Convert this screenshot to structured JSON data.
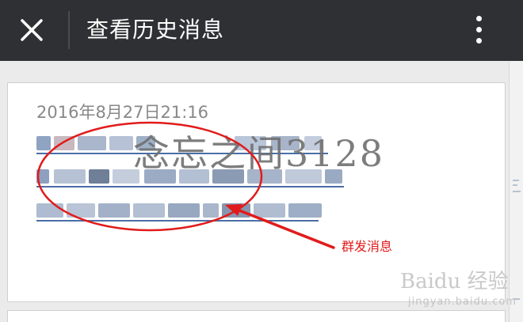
{
  "header": {
    "title": "查看历史消息"
  },
  "message": {
    "timestamp": "2016年8月27日21:16"
  },
  "watermark": "念忘之间3128",
  "annotation": {
    "label": "群发消息"
  },
  "baidu": {
    "logo": "Baidu 经验",
    "site": "jingyan.baidu.com"
  },
  "colors": {
    "titlebar": "#2f3033",
    "link": "#4a6ea7",
    "annotation": "#e11b1b"
  }
}
